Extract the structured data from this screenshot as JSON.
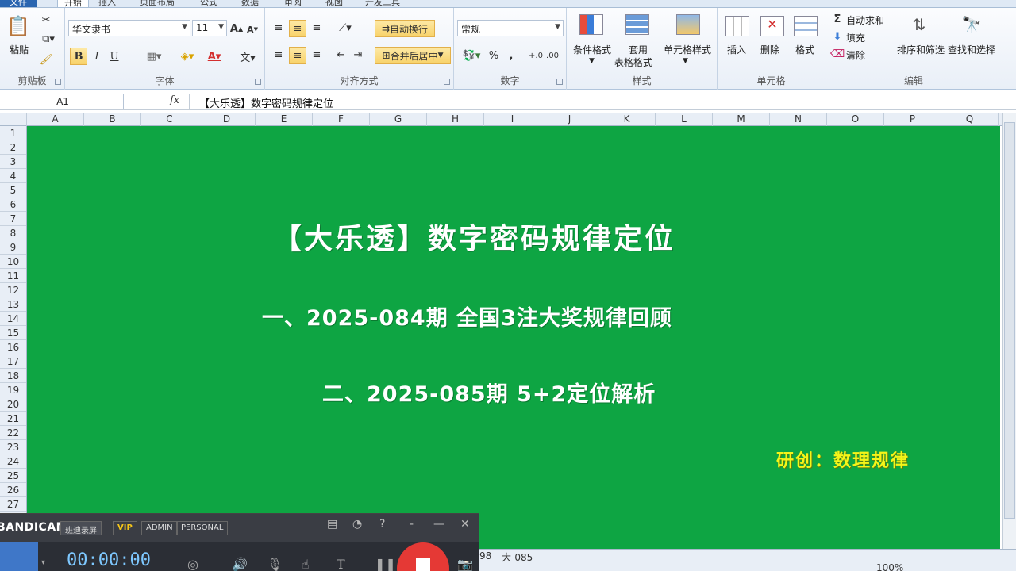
{
  "tabs": {
    "file": "文件",
    "home": "开始",
    "insert": "插入",
    "layout": "页面布局",
    "formulas": "公式",
    "data": "数据",
    "review": "审阅",
    "view": "视图",
    "dev": "开发工具"
  },
  "clipboard": {
    "paste": "粘贴",
    "label": "剪贴板"
  },
  "font": {
    "name": "华文隶书",
    "size": "11",
    "bold": "B",
    "italic": "I",
    "underline": "U",
    "label": "字体"
  },
  "align": {
    "wrap": "自动换行",
    "merge": "合并后居中",
    "label": "对齐方式"
  },
  "number": {
    "format": "常规",
    "percent": "%",
    "comma": ",",
    "label": "数字"
  },
  "styles": {
    "conditional": "条件格式",
    "table1": "套用",
    "table2": "表格格式",
    "cell": "单元格样式",
    "label": "样式"
  },
  "cells": {
    "insert": "插入",
    "delete": "删除",
    "format": "格式",
    "label": "单元格"
  },
  "editing": {
    "autosum": "自动求和",
    "fill": "填充",
    "clear": "清除",
    "sort": "排序和筛选",
    "find": "查找和选择",
    "label": "编辑"
  },
  "formula_bar": {
    "cell_ref": "A1",
    "fx": "fx",
    "content": "【大乐透】数字密码规律定位"
  },
  "columns": [
    "A",
    "B",
    "C",
    "D",
    "E",
    "F",
    "G",
    "H",
    "I",
    "J",
    "K",
    "L",
    "M",
    "N",
    "O",
    "P",
    "Q"
  ],
  "rows": [
    "1",
    "2",
    "3",
    "4",
    "5",
    "6",
    "7",
    "8",
    "9",
    "10",
    "11",
    "12",
    "13",
    "14",
    "15",
    "16",
    "17",
    "18",
    "19",
    "20",
    "21",
    "22",
    "23",
    "24",
    "25",
    "26",
    "27"
  ],
  "sheet": {
    "title": "【大乐透】数字密码规律定位",
    "line1": "一、2025-084期  全国3注大奖规律回顾",
    "line2": "二、2025-085期  5+2定位解析",
    "credit": "研创：数理规律"
  },
  "sheet_tabs": {
    "tab1": "98",
    "tab2": "大-085"
  },
  "zoom": "100%",
  "bandicam": {
    "logo": "BANDICAM",
    "product": "班迪录屏",
    "vip": "VIP",
    "admin": "ADMIN",
    "personal": "PERSONAL",
    "time": "00:00:00"
  }
}
